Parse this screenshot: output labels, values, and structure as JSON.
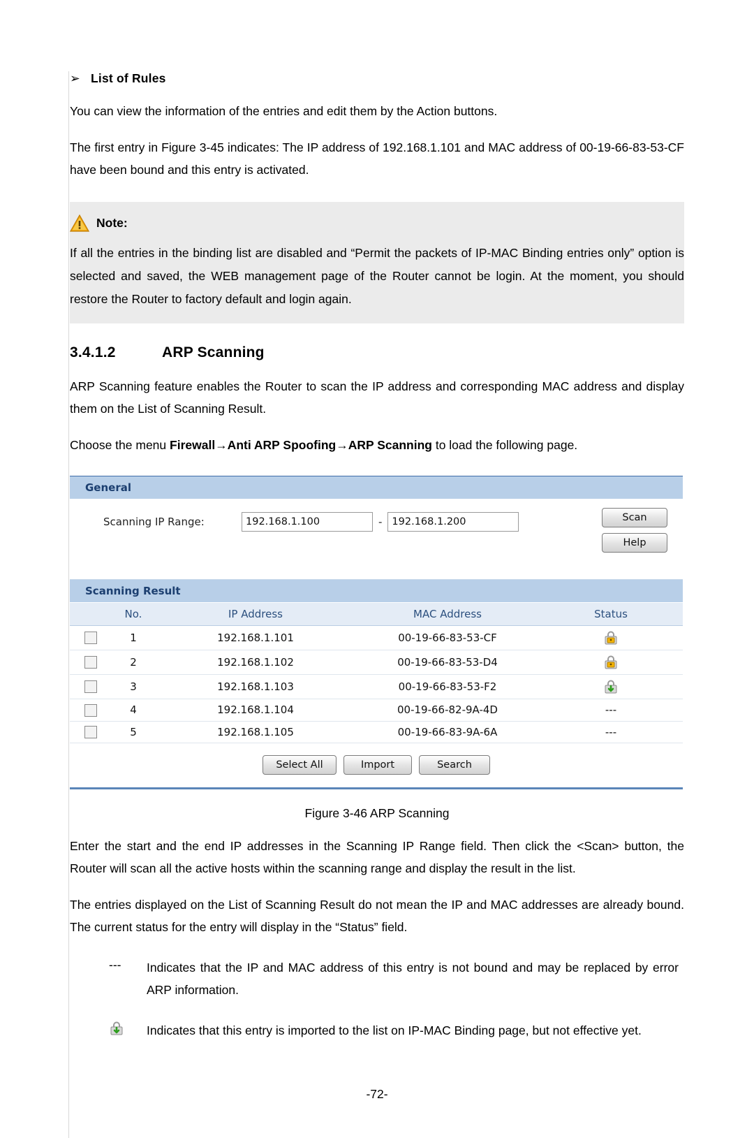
{
  "section_bullet": {
    "arrow": "➢",
    "label": "List of Rules"
  },
  "paragraphs": {
    "p1": "You can view the information of the entries and edit them by the Action buttons.",
    "p2": "The first entry in Figure 3-45 indicates: The IP address of 192.168.1.101 and MAC address of 00-19-66-83-53-CF have been bound and this entry is activated.",
    "p_arp_intro": "ARP Scanning feature enables the Router to scan the IP address and corresponding MAC address and display them on the List of Scanning Result.",
    "p_menu_pre": "Choose the menu ",
    "p_menu_path": "Firewall→Anti ARP Spoofing→ARP Scanning",
    "p_menu_post": " to load the following page.",
    "p_after_fig1": "Enter the start and the end IP addresses in the Scanning IP Range field. Then click the <Scan> button, the Router will scan all the active hosts within the scanning range and display the result in the list.",
    "p_after_fig2": "The entries displayed on the List of Scanning Result do not mean the IP and MAC addresses are already bound. The current status for the entry will display in the “Status” field."
  },
  "note": {
    "title": "Note:",
    "icon": "warning-triangle-icon",
    "text": "If all the entries in the binding list are disabled and “Permit the packets of IP-MAC Binding entries only” option is selected and saved, the WEB management page of the Router cannot be login. At the moment, you should restore the Router to factory default and login again."
  },
  "heading": {
    "number": "3.4.1.2",
    "title": "ARP Scanning"
  },
  "router_ui": {
    "general_bar": "General",
    "scanning_label": "Scanning IP Range:",
    "ip_start": "192.168.1.100",
    "ip_end": "192.168.1.200",
    "separator": "-",
    "scan_button": "Scan",
    "help_button": "Help",
    "result_bar": "Scanning Result",
    "columns": [
      "No.",
      "IP Address",
      "MAC Address",
      "Status"
    ],
    "rows": [
      {
        "no": "1",
        "ip": "192.168.1.101",
        "mac": "00-19-66-83-53-CF",
        "status": "locked-yellow-icon"
      },
      {
        "no": "2",
        "ip": "192.168.1.102",
        "mac": "00-19-66-83-53-D4",
        "status": "locked-yellow-icon"
      },
      {
        "no": "3",
        "ip": "192.168.1.103",
        "mac": "00-19-66-83-53-F2",
        "status": "import-green-icon"
      },
      {
        "no": "4",
        "ip": "192.168.1.104",
        "mac": "00-19-66-82-9A-4D",
        "status": "---"
      },
      {
        "no": "5",
        "ip": "192.168.1.105",
        "mac": "00-19-66-83-9A-6A",
        "status": "---"
      }
    ],
    "select_all_button": "Select All",
    "import_button": "Import",
    "search_button": "Search"
  },
  "figure_caption": "Figure 3-46 ARP Scanning",
  "legend": [
    {
      "mark": "---",
      "icon": "",
      "text": "Indicates that the IP and MAC address of this entry is not bound and may be replaced by error ARP information."
    },
    {
      "mark": "",
      "icon": "import-green-icon",
      "text": "Indicates that this entry is imported to the list on IP-MAC Binding page, but not effective yet."
    }
  ],
  "page_number": "-72-",
  "colors": {
    "bar_blue": "#b8cfe8",
    "bar_text": "#1c3f70",
    "header_row": "#e4ecf6",
    "note_bg": "#ebebeb",
    "rule_blue": "#5a85b8"
  }
}
